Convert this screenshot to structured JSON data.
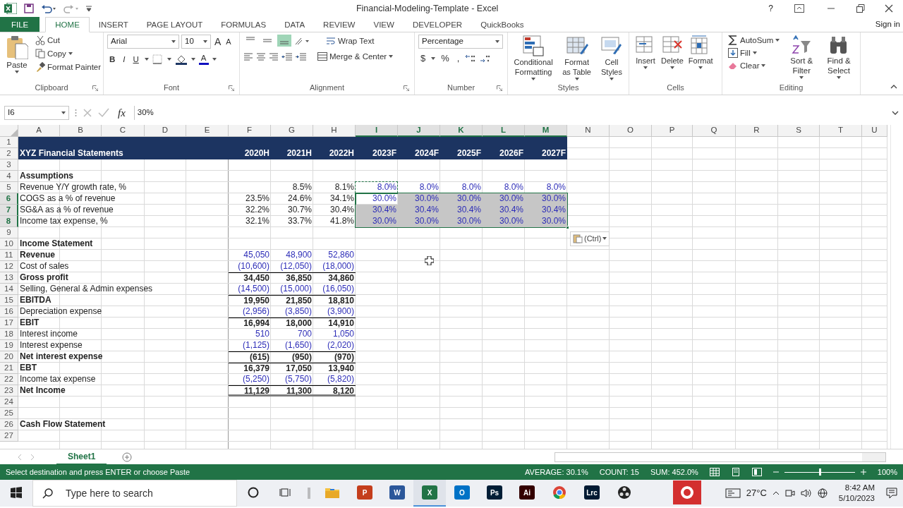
{
  "title_bar": {
    "title": "Financial-Modeling-Template - Excel",
    "help": "?"
  },
  "ribbon_tabs": [
    {
      "label": "FILE",
      "kind": "file",
      "selected": false
    },
    {
      "label": "HOME",
      "kind": "tab",
      "selected": true
    },
    {
      "label": "INSERT",
      "kind": "tab",
      "selected": false
    },
    {
      "label": "PAGE LAYOUT",
      "kind": "tab",
      "selected": false
    },
    {
      "label": "FORMULAS",
      "kind": "tab",
      "selected": false
    },
    {
      "label": "DATA",
      "kind": "tab",
      "selected": false
    },
    {
      "label": "REVIEW",
      "kind": "tab",
      "selected": false
    },
    {
      "label": "VIEW",
      "kind": "tab",
      "selected": false
    },
    {
      "label": "DEVELOPER",
      "kind": "tab",
      "selected": false
    },
    {
      "label": "QuickBooks",
      "kind": "tab",
      "selected": false
    }
  ],
  "sign_in": "Sign in",
  "ribbon": {
    "clipboard": {
      "paste": "Paste",
      "cut": "Cut",
      "copy": "Copy",
      "format_painter": "Format Painter",
      "label": "Clipboard"
    },
    "font": {
      "name": "Arial",
      "size": "10",
      "size_buttons": [
        "A",
        "A"
      ],
      "style_buttons": [
        "B",
        "I",
        "U"
      ],
      "color_button": "A",
      "label": "Font"
    },
    "alignment": {
      "vertical": [
        {
          "selected": false
        },
        {
          "selected": false
        },
        {
          "selected": true
        }
      ],
      "wrap_text": "Wrap Text",
      "merge_center": "Merge & Center",
      "label": "Alignment"
    },
    "number": {
      "format": "Percentage",
      "symbols": [
        "$",
        "%",
        ","
      ],
      "label": "Number"
    },
    "styles": {
      "buttons": [
        "Conditional Formatting",
        "Format as Table",
        "Cell Styles"
      ],
      "label": "Styles"
    },
    "cells": {
      "buttons": [
        "Insert",
        "Delete",
        "Format"
      ],
      "label": "Cells"
    },
    "editing": {
      "autosum": "AutoSum",
      "fill": "Fill",
      "clear": "Clear",
      "sort_filter": "Sort & Filter",
      "find_select": "Find & Select",
      "label": "Editing"
    }
  },
  "formula_bar": {
    "name_box": "I6",
    "fx": "fx",
    "formula": "30%"
  },
  "columns": [
    {
      "letter": "A",
      "selected": false
    },
    {
      "letter": "B",
      "selected": false
    },
    {
      "letter": "C",
      "selected": false
    },
    {
      "letter": "D",
      "selected": false
    },
    {
      "letter": "E",
      "selected": false
    },
    {
      "letter": "F",
      "selected": false
    },
    {
      "letter": "G",
      "selected": false
    },
    {
      "letter": "H",
      "selected": false
    },
    {
      "letter": "I",
      "selected": true
    },
    {
      "letter": "J",
      "selected": true
    },
    {
      "letter": "K",
      "selected": true
    },
    {
      "letter": "L",
      "selected": true
    },
    {
      "letter": "M",
      "selected": true
    },
    {
      "letter": "N",
      "selected": false
    },
    {
      "letter": "O",
      "selected": false
    },
    {
      "letter": "P",
      "selected": false
    },
    {
      "letter": "Q",
      "selected": false
    },
    {
      "letter": "R",
      "selected": false
    },
    {
      "letter": "S",
      "selected": false
    },
    {
      "letter": "T",
      "selected": false
    },
    {
      "letter": "U",
      "selected": false
    }
  ],
  "rows": [
    {
      "number": "1",
      "kind": "banner",
      "selected": false,
      "copied": false
    },
    {
      "number": "2",
      "kind": "banner",
      "selected": false,
      "copied": false,
      "label": "XYZ Financial Statements",
      "historical": [
        {
          "text": "2020H",
          "input": false
        },
        {
          "text": "2021H",
          "input": false
        },
        {
          "text": "2022H",
          "input": false
        }
      ],
      "forecast": [
        {
          "text": "2023F",
          "input": false
        },
        {
          "text": "2024F",
          "input": false
        },
        {
          "text": "2025F",
          "input": false
        },
        {
          "text": "2026F",
          "input": false
        },
        {
          "text": "2027F",
          "input": false
        }
      ]
    },
    {
      "number": "3",
      "kind": "plain",
      "selected": false,
      "copied": false
    },
    {
      "number": "4",
      "kind": "section",
      "selected": false,
      "copied": false,
      "label": "Assumptions"
    },
    {
      "number": "5",
      "kind": "plain",
      "selected": false,
      "copied": true,
      "label": "Revenue Y/Y growth rate, %",
      "historical": [
        {
          "text": "8.5%",
          "input": false
        },
        {
          "text": "8.1%",
          "input": false
        }
      ],
      "forecast": [
        {
          "text": "8.0%",
          "input": true
        },
        {
          "text": "8.0%",
          "input": true
        },
        {
          "text": "8.0%",
          "input": true
        },
        {
          "text": "8.0%",
          "input": true
        },
        {
          "text": "8.0%",
          "input": true
        }
      ]
    },
    {
      "number": "6",
      "kind": "plain",
      "selected": true,
      "copied": false,
      "label": "COGS as a % of revenue",
      "historical": [
        {
          "text": "23.5%",
          "input": false
        },
        {
          "text": "24.6%",
          "input": false
        },
        {
          "text": "34.1%",
          "input": false
        }
      ],
      "forecast": [
        {
          "text": "30.0%",
          "input": true
        },
        {
          "text": "30.0%",
          "input": true
        },
        {
          "text": "30.0%",
          "input": true
        },
        {
          "text": "30.0%",
          "input": true
        },
        {
          "text": "30.0%",
          "input": true
        }
      ]
    },
    {
      "number": "7",
      "kind": "plain",
      "selected": true,
      "copied": false,
      "label": "SG&A as a % of revenue",
      "historical": [
        {
          "text": "32.2%",
          "input": false
        },
        {
          "text": "30.7%",
          "input": false
        },
        {
          "text": "30.4%",
          "input": false
        }
      ],
      "forecast": [
        {
          "text": "30.4%",
          "input": true
        },
        {
          "text": "30.4%",
          "input": true
        },
        {
          "text": "30.4%",
          "input": true
        },
        {
          "text": "30.4%",
          "input": true
        },
        {
          "text": "30.4%",
          "input": true
        }
      ]
    },
    {
      "number": "8",
      "kind": "plain",
      "selected": true,
      "copied": false,
      "label": "Income tax expense, %",
      "historical": [
        {
          "text": "32.1%",
          "input": false
        },
        {
          "text": "33.7%",
          "input": false
        },
        {
          "text": "41.8%",
          "input": false
        }
      ],
      "forecast": [
        {
          "text": "30.0%",
          "input": true
        },
        {
          "text": "30.0%",
          "input": true
        },
        {
          "text": "30.0%",
          "input": true
        },
        {
          "text": "30.0%",
          "input": true
        },
        {
          "text": "30.0%",
          "input": true
        }
      ]
    },
    {
      "number": "9",
      "kind": "plain",
      "selected": false,
      "copied": false
    },
    {
      "number": "10",
      "kind": "section",
      "selected": false,
      "copied": false,
      "label": "Income Statement"
    },
    {
      "number": "11",
      "kind": "section",
      "selected": false,
      "copied": false,
      "label": "Revenue",
      "historical": [
        {
          "text": "45,050",
          "input": true
        },
        {
          "text": "48,900",
          "input": true
        },
        {
          "text": "52,860",
          "input": true
        }
      ]
    },
    {
      "number": "12",
      "kind": "plain",
      "selected": false,
      "copied": false,
      "label": "Cost of sales",
      "historical": [
        {
          "text": "(10,600)",
          "input": true
        },
        {
          "text": "(12,050)",
          "input": true
        },
        {
          "text": "(18,000)",
          "input": true
        }
      ]
    },
    {
      "number": "13",
      "kind": "total",
      "selected": false,
      "copied": false,
      "label": "Gross profit",
      "historical": [
        {
          "text": "34,450",
          "input": false
        },
        {
          "text": "36,850",
          "input": false
        },
        {
          "text": "34,860",
          "input": false
        }
      ]
    },
    {
      "number": "14",
      "kind": "plain",
      "selected": false,
      "copied": false,
      "label": "Selling, General & Admin expenses",
      "historical": [
        {
          "text": "(14,500)",
          "input": true
        },
        {
          "text": "(15,000)",
          "input": true
        },
        {
          "text": "(16,050)",
          "input": true
        }
      ]
    },
    {
      "number": "15",
      "kind": "total",
      "selected": false,
      "copied": false,
      "label": "EBITDA",
      "historical": [
        {
          "text": "19,950",
          "input": false
        },
        {
          "text": "21,850",
          "input": false
        },
        {
          "text": "18,810",
          "input": false
        }
      ]
    },
    {
      "number": "16",
      "kind": "plain",
      "selected": false,
      "copied": false,
      "label": "Depreciation expense",
      "historical": [
        {
          "text": "(2,956)",
          "input": true
        },
        {
          "text": "(3,850)",
          "input": true
        },
        {
          "text": "(3,900)",
          "input": true
        }
      ]
    },
    {
      "number": "17",
      "kind": "total",
      "selected": false,
      "copied": false,
      "label": "EBIT",
      "historical": [
        {
          "text": "16,994",
          "input": false
        },
        {
          "text": "18,000",
          "input": false
        },
        {
          "text": "14,910",
          "input": false
        }
      ]
    },
    {
      "number": "18",
      "kind": "plain",
      "selected": false,
      "copied": false,
      "label": "Interest income",
      "historical": [
        {
          "text": "510",
          "input": true
        },
        {
          "text": "700",
          "input": true
        },
        {
          "text": "1,050",
          "input": true
        }
      ]
    },
    {
      "number": "19",
      "kind": "plain",
      "selected": false,
      "copied": false,
      "label": "Interest expense",
      "historical": [
        {
          "text": "(1,125)",
          "input": true
        },
        {
          "text": "(1,650)",
          "input": true
        },
        {
          "text": "(2,020)",
          "input": true
        }
      ]
    },
    {
      "number": "20",
      "kind": "total",
      "selected": false,
      "copied": false,
      "label": "Net interest expense",
      "historical": [
        {
          "text": "(615)",
          "input": false
        },
        {
          "text": "(950)",
          "input": false
        },
        {
          "text": "(970)",
          "input": false
        }
      ]
    },
    {
      "number": "21",
      "kind": "total",
      "selected": false,
      "copied": false,
      "label": "EBT",
      "historical": [
        {
          "text": "16,379",
          "input": false
        },
        {
          "text": "17,050",
          "input": false
        },
        {
          "text": "13,940",
          "input": false
        }
      ]
    },
    {
      "number": "22",
      "kind": "plain",
      "selected": false,
      "copied": false,
      "label": "Income tax expense",
      "historical": [
        {
          "text": "(5,250)",
          "input": true
        },
        {
          "text": "(5,750)",
          "input": true
        },
        {
          "text": "(5,820)",
          "input": true
        }
      ]
    },
    {
      "number": "23",
      "kind": "net",
      "selected": false,
      "copied": false,
      "label": "Net Income",
      "historical": [
        {
          "text": "11,129",
          "input": false
        },
        {
          "text": "11,300",
          "input": false
        },
        {
          "text": "8,120",
          "input": false
        }
      ]
    },
    {
      "number": "24",
      "kind": "plain",
      "selected": false,
      "copied": false
    },
    {
      "number": "25",
      "kind": "plain",
      "selected": false,
      "copied": false
    },
    {
      "number": "26",
      "kind": "section",
      "selected": false,
      "copied": false,
      "label": "Cash Flow Statement"
    },
    {
      "number": "27",
      "kind": "plain",
      "selected": false,
      "copied": false
    }
  ],
  "paste_options": {
    "label": "(Ctrl)"
  },
  "sheet_tabs": [
    {
      "label": "Sheet1",
      "selected": true
    }
  ],
  "status_bar": {
    "message": "Select destination and press ENTER or choose Paste",
    "stats": [
      "AVERAGE: 30.1%",
      "COUNT: 15",
      "SUM: 452.0%"
    ],
    "zoom": {
      "level": 0.5,
      "reading": "100%"
    }
  },
  "taskbar": {
    "search": {
      "placeholder": "Type here to search"
    },
    "apps": [
      {
        "kind": "cortana",
        "selected": false
      },
      {
        "kind": "taskview",
        "selected": false
      },
      {
        "kind": "folder",
        "selected": false
      },
      {
        "kind": "tile",
        "label": "P",
        "color": "#c43e1c",
        "selected": false
      },
      {
        "kind": "tile",
        "label": "W",
        "color": "#2b579a",
        "selected": false
      },
      {
        "kind": "tile",
        "label": "X",
        "color": "#217346",
        "selected": true
      },
      {
        "kind": "tile",
        "label": "O",
        "color": "#0072c6",
        "selected": false
      },
      {
        "kind": "tile",
        "label": "Ps",
        "color": "#001e36",
        "selected": false
      },
      {
        "kind": "tile",
        "label": "Ai",
        "color": "#330000",
        "selected": false
      },
      {
        "kind": "chrome",
        "selected": false
      },
      {
        "kind": "tile",
        "label": "Lrc",
        "color": "#001a33",
        "selected": false
      },
      {
        "kind": "obs",
        "selected": false
      },
      {
        "kind": "redapp",
        "selected": false
      }
    ],
    "weather": "27°C",
    "time": "8:42 AM",
    "date": "5/10/2023"
  }
}
